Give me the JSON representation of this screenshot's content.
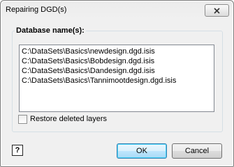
{
  "window": {
    "title": "Repairing DGD(s)"
  },
  "group": {
    "label": "Database name(s):",
    "items": [
      "C:\\DataSets\\Basics\\newdesign.dgd.isis",
      "C:\\DataSets\\Basics\\Bobdesign.dgd.isis",
      "C:\\DataSets\\Basics\\Dandesign.dgd.isis",
      "C:\\DataSets\\Basics\\Tannimootdesign.dgd.isis"
    ]
  },
  "options": {
    "restore_label": "Restore deleted layers",
    "restore_checked": false
  },
  "footer": {
    "help_label": "?",
    "ok_label": "OK",
    "cancel_label": "Cancel"
  }
}
